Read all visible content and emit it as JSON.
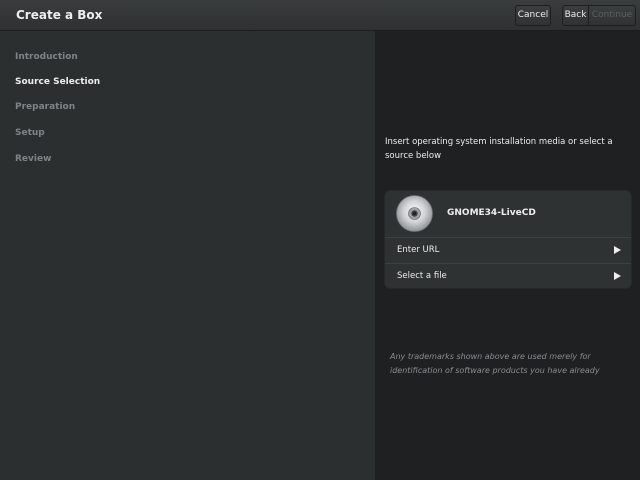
{
  "header": {
    "title": "Create a Box",
    "cancel_label": "Cancel",
    "back_label": "Back",
    "continue_label": "Continue"
  },
  "sidebar": {
    "steps": [
      {
        "label": "Introduction",
        "active": false
      },
      {
        "label": "Source Selection",
        "active": true
      },
      {
        "label": "Preparation",
        "active": false
      },
      {
        "label": "Setup",
        "active": false
      },
      {
        "label": "Review",
        "active": false
      }
    ]
  },
  "main": {
    "prompt": "Insert operating system installation media or select a source below",
    "sources": {
      "media": {
        "label": "GNOME34-LiveCD",
        "icon": "optical-disc-icon"
      },
      "enter_url": {
        "label": "Enter URL",
        "icon": "arrow-right-icon"
      },
      "select_file": {
        "label": "Select a file",
        "icon": "arrow-right-icon"
      }
    },
    "trademark": "Any trademarks shown above are used merely for identification of software products you have already"
  },
  "colors": {
    "accent_text": "#eeeeec",
    "muted_text": "#7e8385",
    "main_background": "#1e2021",
    "sidebar_background": "#2b2f30"
  }
}
